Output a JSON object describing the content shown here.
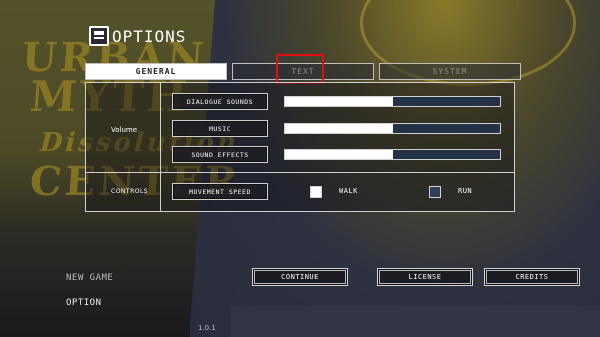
{
  "window": {
    "title": "OPTIONS",
    "title_icon": "options-book-icon"
  },
  "background": {
    "logo_lines": [
      "URBAN",
      "MYTH",
      "Dissolution",
      "CENTER"
    ],
    "accent_gold": "#8a7a2a"
  },
  "tabs": [
    {
      "label": "GENERAL",
      "active": true
    },
    {
      "label": "TEXT",
      "active": false,
      "highlighted": true
    },
    {
      "label": "SYSTEM",
      "active": false
    }
  ],
  "volume": {
    "section_label": "Volume",
    "rows": [
      {
        "label": "DIALOGUE SOUNDS",
        "value": 0.5
      },
      {
        "label": "MUSIC",
        "value": 0.5
      },
      {
        "label": "SOUND EFFECTS",
        "value": 0.5
      }
    ]
  },
  "controls": {
    "section_label": "CONTROLS",
    "movement_label": "MOVEMENT SPEED",
    "options": [
      {
        "label": "WALK",
        "checked": true
      },
      {
        "label": "RUN",
        "checked": false
      }
    ]
  },
  "buttons": {
    "continue": "CONTINUE",
    "license": "LICENSE",
    "credits": "CREDITS"
  },
  "side_menu": {
    "new_game": "NEW GAME",
    "option": "OPTION"
  },
  "version": "1.0.1",
  "colors": {
    "slider_track": "#243247",
    "slider_fill": "#ffffff",
    "highlight": "#e01010"
  }
}
